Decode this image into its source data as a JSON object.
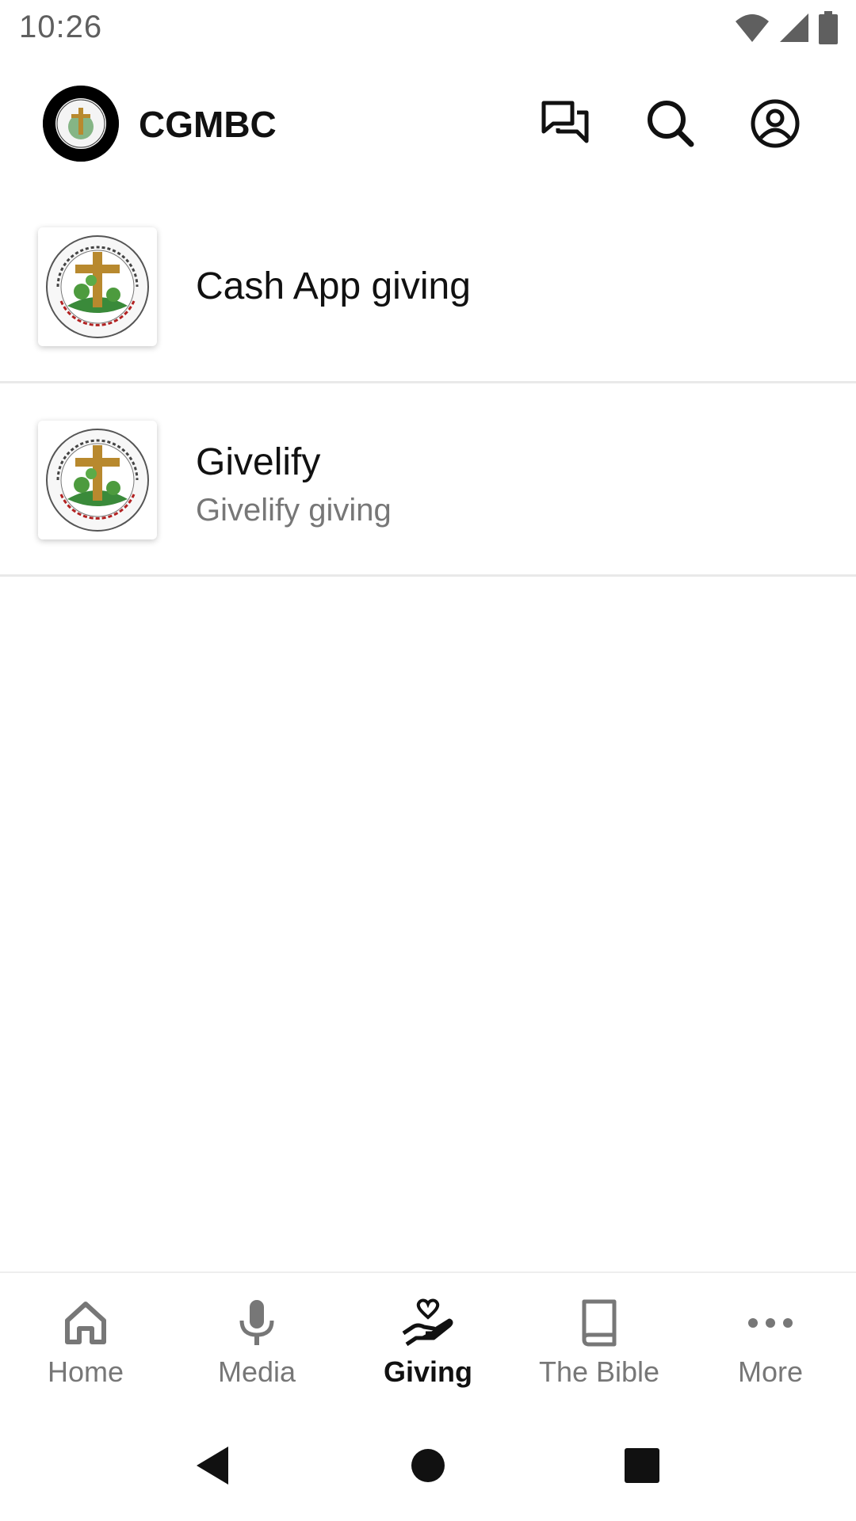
{
  "status_bar": {
    "time": "10:26",
    "icons": [
      "wifi-icon",
      "cell-signal-icon",
      "battery-icon"
    ]
  },
  "app_bar": {
    "title": "CGMBC",
    "logo_text": "Cherry Grove Missionary Baptist Church",
    "actions": [
      "chat-icon",
      "search-icon",
      "account-icon"
    ]
  },
  "giving_list": [
    {
      "title": "Cash App giving",
      "subtitle": "",
      "thumbnail": "church-seal-logo"
    },
    {
      "title": "Givelify",
      "subtitle": "Givelify giving",
      "thumbnail": "church-seal-logo"
    }
  ],
  "bottom_nav": {
    "active": "Giving",
    "items": [
      {
        "label": "Home",
        "icon": "home-icon"
      },
      {
        "label": "Media",
        "icon": "microphone-icon"
      },
      {
        "label": "Giving",
        "icon": "giving-hand-heart-icon"
      },
      {
        "label": "The Bible",
        "icon": "book-icon"
      },
      {
        "label": "More",
        "icon": "more-horizontal-icon"
      }
    ]
  },
  "system_nav": [
    "back-icon",
    "home-circle-icon",
    "recents-icon"
  ],
  "colors": {
    "background": "#ffffff",
    "text_primary": "#111111",
    "text_secondary": "#777777",
    "divider": "#e9e9e9",
    "seal_gold": "#b8892e",
    "seal_green": "#3a8a3a",
    "seal_red": "#b22222"
  }
}
